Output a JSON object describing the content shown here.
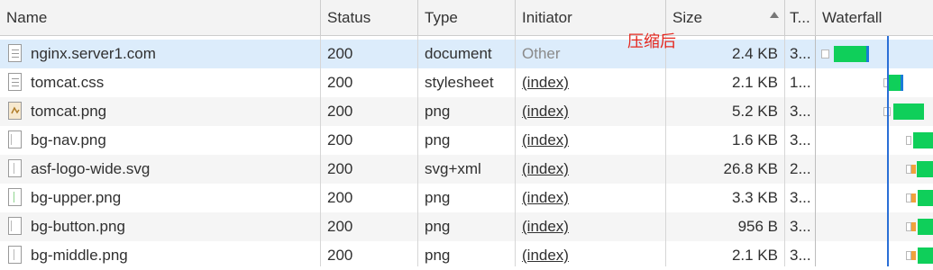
{
  "header": {
    "name": "Name",
    "status": "Status",
    "type": "Type",
    "initiator": "Initiator",
    "size": "Size",
    "time": "T...",
    "waterfall": "Waterfall"
  },
  "annotation": "压缩后",
  "rows": [
    {
      "name": "nginx.server1.com",
      "status": "200",
      "type": "document",
      "initiator": "Other",
      "size": "2.4 KB",
      "time": "3...",
      "icon": "document-icon"
    },
    {
      "name": "tomcat.css",
      "status": "200",
      "type": "stylesheet",
      "initiator": "(index)",
      "size": "2.1 KB",
      "time": "1...",
      "icon": "stylesheet-icon"
    },
    {
      "name": "tomcat.png",
      "status": "200",
      "type": "png",
      "initiator": "(index)",
      "size": "5.2 KB",
      "time": "3...",
      "icon": "image-thumbnail-icon"
    },
    {
      "name": "bg-nav.png",
      "status": "200",
      "type": "png",
      "initiator": "(index)",
      "size": "1.6 KB",
      "time": "3...",
      "icon": "image-thumbnail-icon"
    },
    {
      "name": "asf-logo-wide.svg",
      "status": "200",
      "type": "svg+xml",
      "initiator": "(index)",
      "size": "26.8 KB",
      "time": "2...",
      "icon": "image-thumbnail-icon"
    },
    {
      "name": "bg-upper.png",
      "status": "200",
      "type": "png",
      "initiator": "(index)",
      "size": "3.3 KB",
      "time": "3...",
      "icon": "image-thumbnail-icon"
    },
    {
      "name": "bg-button.png",
      "status": "200",
      "type": "png",
      "initiator": "(index)",
      "size": "956 B",
      "time": "3...",
      "icon": "image-thumbnail-icon"
    },
    {
      "name": "bg-middle.png",
      "status": "200",
      "type": "png",
      "initiator": "(index)",
      "size": "2.1 KB",
      "time": "3...",
      "icon": "image-thumbnail-icon"
    }
  ],
  "colors": {
    "waterfall_download": "#0fcf5a",
    "dom_content_loaded_line": "#2a6fd6",
    "annotation": "#e5281f",
    "selected_row": "#dcecfb"
  }
}
